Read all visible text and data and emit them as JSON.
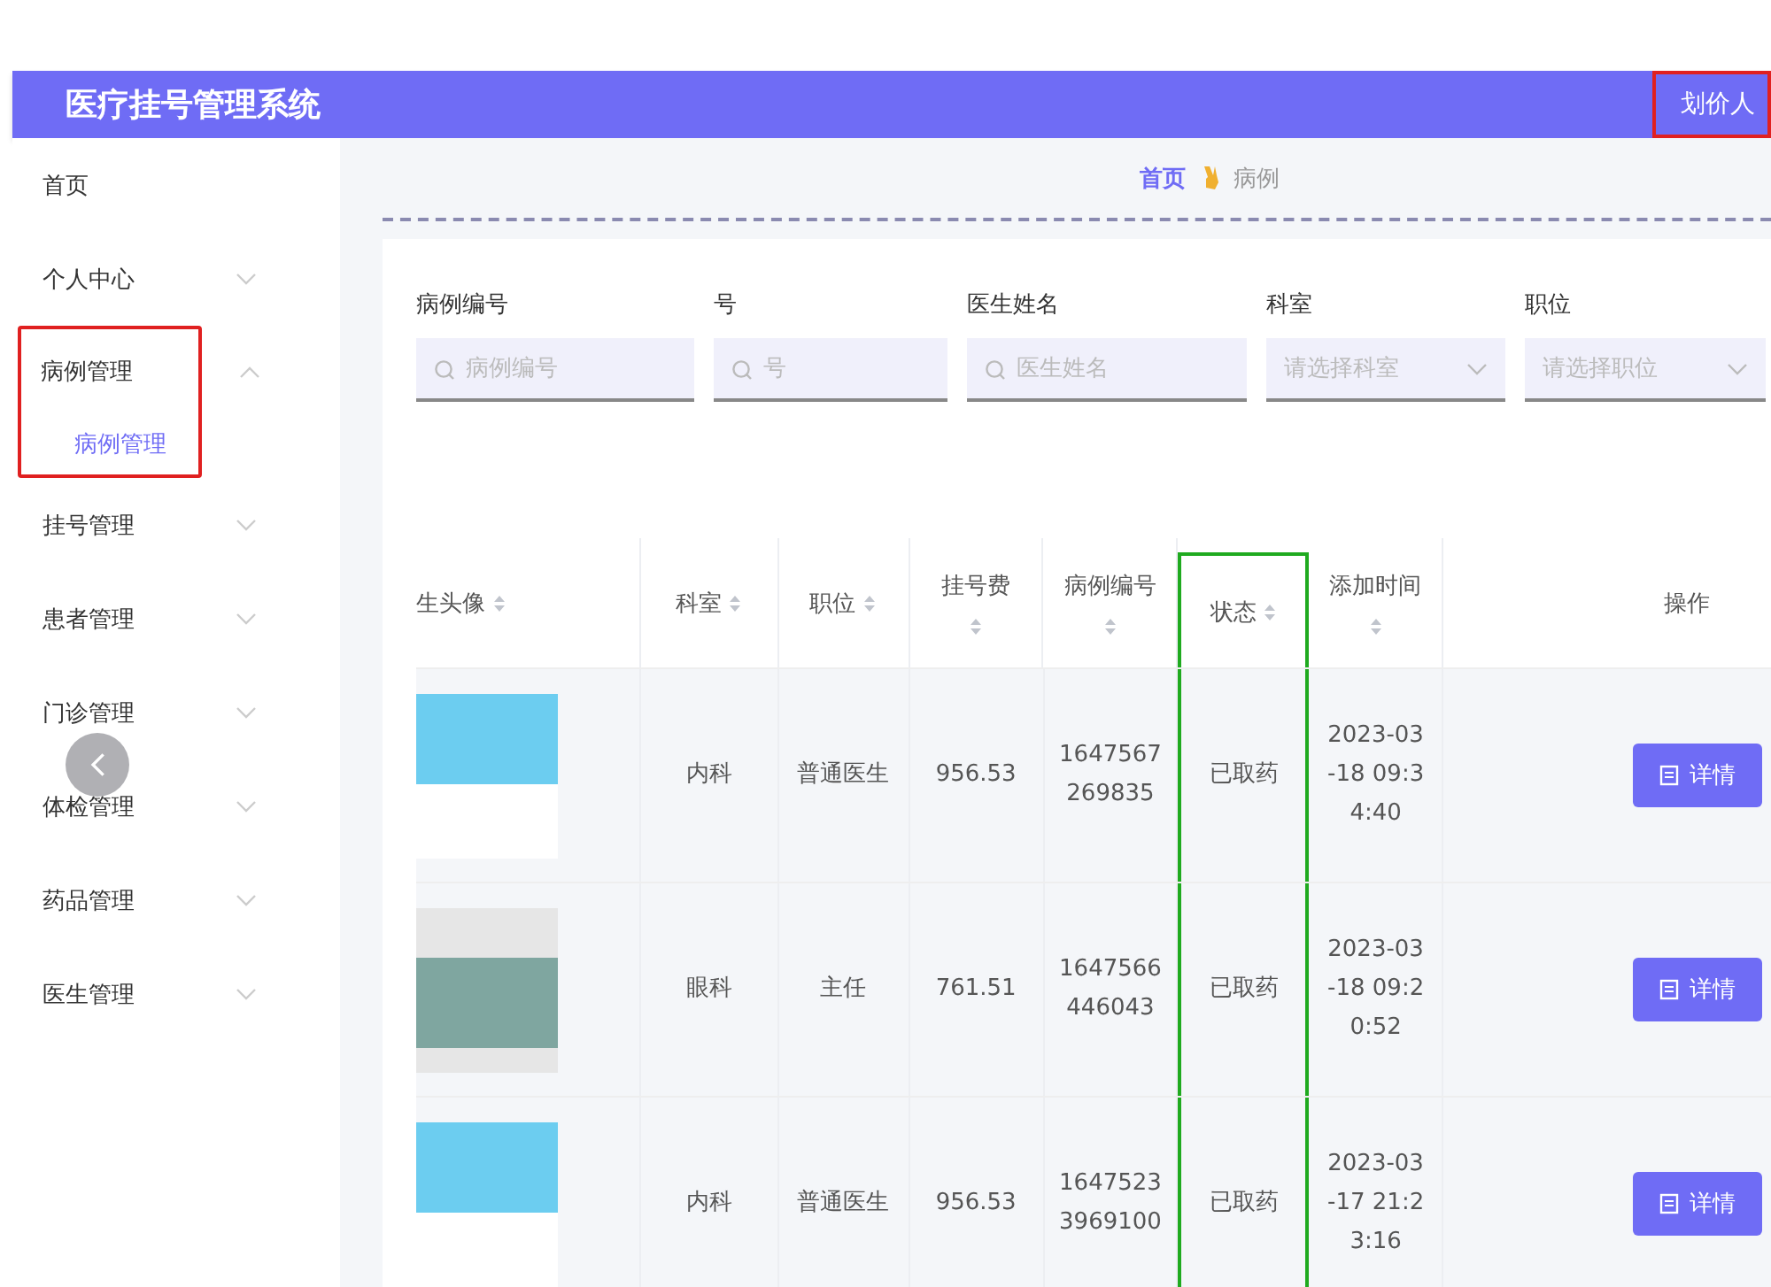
{
  "header": {
    "title": "医疗挂号管理系统",
    "user_button": "划价人"
  },
  "sidebar": {
    "items": [
      {
        "label": "首页",
        "has_arrow": false,
        "highlighted": false
      },
      {
        "label": "个人中心",
        "has_arrow": true,
        "expanded": false,
        "highlighted": false
      },
      {
        "label": "病例管理",
        "has_arrow": true,
        "expanded": true,
        "highlighted": true,
        "children": [
          {
            "label": "病例管理",
            "selected": true
          }
        ]
      },
      {
        "label": "挂号管理",
        "has_arrow": true,
        "expanded": false,
        "highlighted": false
      },
      {
        "label": "患者管理",
        "has_arrow": true,
        "expanded": false,
        "highlighted": false
      },
      {
        "label": "门诊管理",
        "has_arrow": true,
        "expanded": false,
        "highlighted": false
      },
      {
        "label": "体检管理",
        "has_arrow": true,
        "expanded": false,
        "highlighted": false
      },
      {
        "label": "药品管理",
        "has_arrow": true,
        "expanded": false,
        "highlighted": false
      },
      {
        "label": "医生管理",
        "has_arrow": true,
        "expanded": false,
        "highlighted": false
      }
    ]
  },
  "breadcrumb": [
    {
      "label": "首页",
      "selected": true
    },
    {
      "label": "病例",
      "selected": false
    }
  ],
  "filters": [
    {
      "kind": "search",
      "label": "病例编号",
      "placeholder": "病例编号"
    },
    {
      "kind": "search",
      "label": "号",
      "placeholder": "号"
    },
    {
      "kind": "search",
      "label": "医生姓名",
      "placeholder": "医生姓名"
    },
    {
      "kind": "select",
      "label": "科室",
      "placeholder": "请选择科室"
    },
    {
      "kind": "select",
      "label": "职位",
      "placeholder": "请选择职位"
    }
  ],
  "table": {
    "columns": [
      {
        "label": "生头像",
        "sortable": true,
        "highlighted": false
      },
      {
        "label": "科室",
        "sortable": true,
        "highlighted": false
      },
      {
        "label": "职位",
        "sortable": true,
        "highlighted": false
      },
      {
        "label": "挂号费",
        "sortable": true,
        "highlighted": false
      },
      {
        "label": "病例编号",
        "sortable": true,
        "highlighted": false
      },
      {
        "label": "状态",
        "sortable": true,
        "highlighted": true
      },
      {
        "label": "添加时间",
        "sortable": true,
        "highlighted": false
      },
      {
        "label": "操作",
        "sortable": false,
        "highlighted": false
      }
    ],
    "rows": [
      {
        "avatar": {
          "kind": "cartoon"
        },
        "cells": [
          "",
          "内科",
          "普通医生",
          "956.53",
          "1647567269835",
          "已取药",
          "2023-03-18 09:34:40"
        ],
        "action": "详情"
      },
      {
        "avatar": {
          "kind": "photo"
        },
        "cells": [
          "",
          "眼科",
          "主任",
          "761.51",
          "1647566446043",
          "已取药",
          "2023-03-18 09:20:52"
        ],
        "action": "详情"
      },
      {
        "avatar": {
          "kind": "cartoon"
        },
        "cells": [
          "",
          "内科",
          "普通医生",
          "956.53",
          "16475233969100",
          "已取药",
          "2023-03-17 21:23:16"
        ],
        "action": "详情"
      }
    ]
  }
}
